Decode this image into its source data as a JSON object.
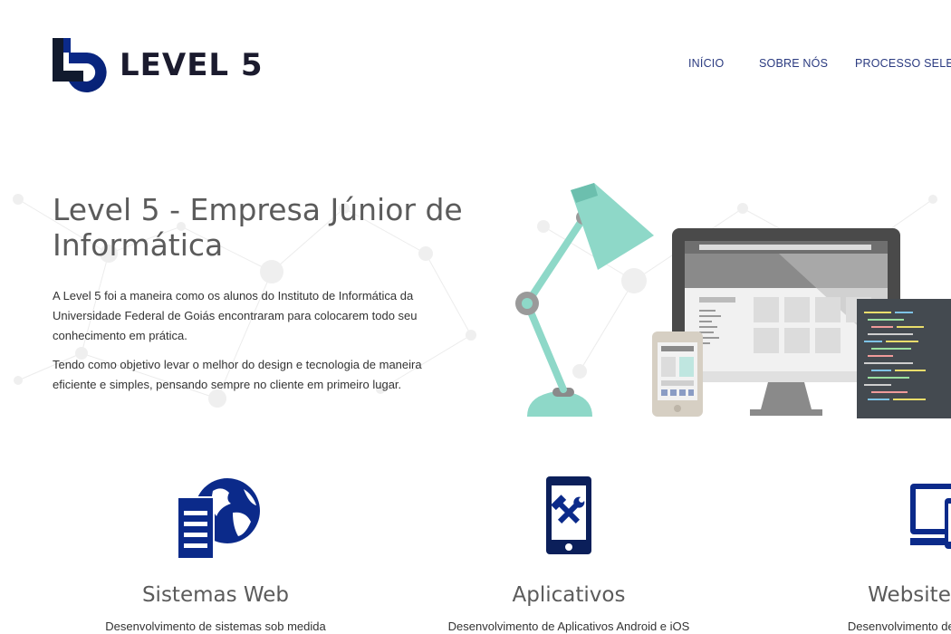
{
  "header": {
    "logo_text": "LEVEL 5",
    "nav": [
      {
        "label": "INÍCIO"
      },
      {
        "label": "SOBRE NÓS"
      },
      {
        "label": "PROCESSO SELETIVO"
      }
    ]
  },
  "hero": {
    "title": "Level 5 - Empresa Júnior de Informática",
    "paragraph1": "A Level 5 foi a maneira como os alunos do Instituto de Informática da Universidade Federal de Goiás encontraram para colocarem todo seu conhecimento em prática.",
    "paragraph2": "Tendo como objetivo levar o melhor do design e tecnologia de maneira eficiente e simples, pensando sempre no cliente em primeiro lugar."
  },
  "services": [
    {
      "title": "Sistemas Web",
      "description": "Desenvolvimento de sistemas sob medida",
      "icon": "server-globe-icon"
    },
    {
      "title": "Aplicativos",
      "description": "Desenvolvimento de Aplicativos Android e iOS",
      "icon": "phone-tools-icon"
    },
    {
      "title": "Websites",
      "description": "Desenvolvimento de sites",
      "icon": "devices-icon"
    }
  ],
  "colors": {
    "brand_dark": "#0b2a8a",
    "nav_text": "#2a3a80",
    "lamp": "#8ed8c8",
    "text_heading": "#5b5b5b"
  }
}
